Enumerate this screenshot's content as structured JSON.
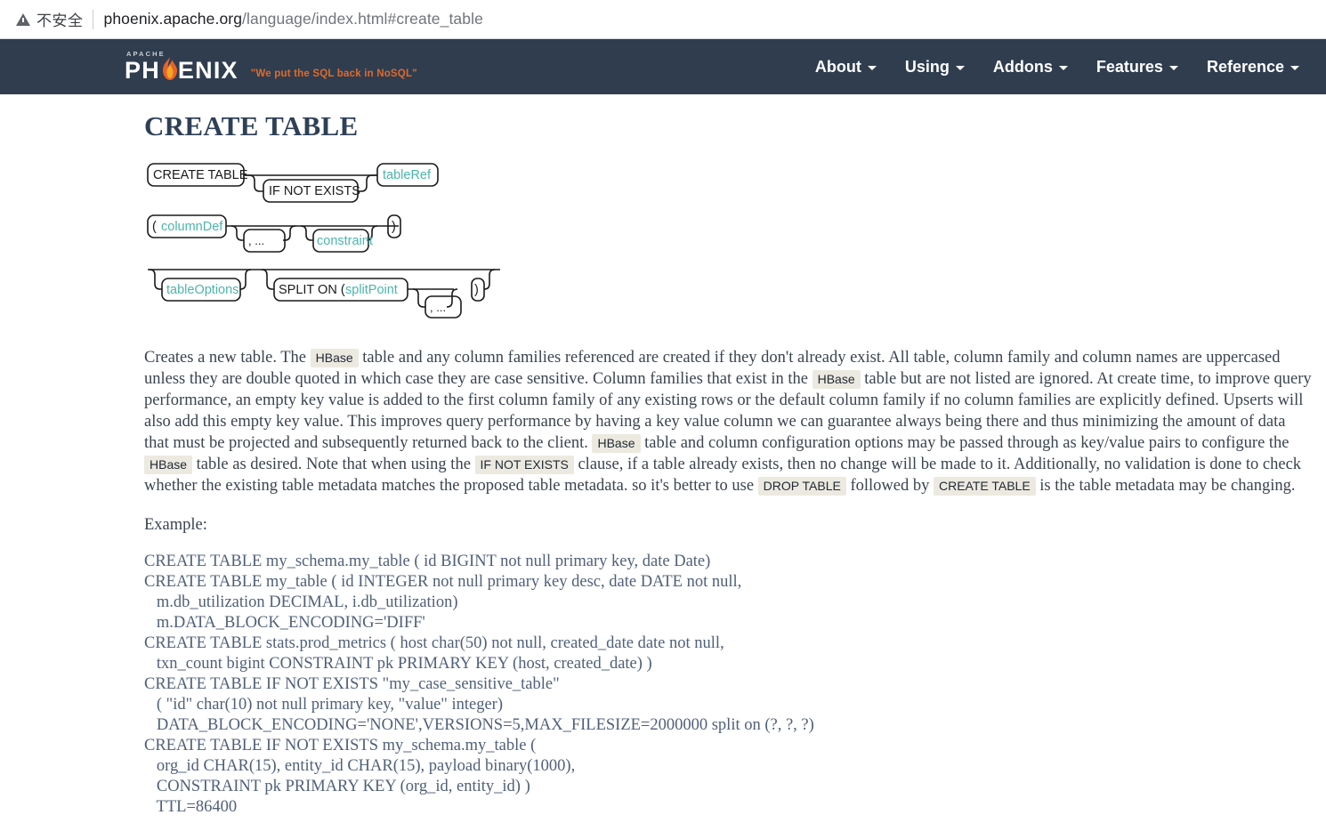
{
  "browser": {
    "security_label": "不安全",
    "warning_icon": "warning-triangle-icon",
    "url_host": "phoenix.apache.org",
    "url_path": "/language/index.html#create_table",
    "url_full": "phoenix.apache.org/language/index.html#create_table"
  },
  "header": {
    "logo_apache": "APACHE",
    "logo_ph": "PH",
    "logo_enix": "ENIX",
    "flame_icon": "flame-icon",
    "tagline": "\"We put the SQL back in NoSQL\"",
    "nav": [
      {
        "label": "About",
        "icon": "chevron-down-icon"
      },
      {
        "label": "Using",
        "icon": "chevron-down-icon"
      },
      {
        "label": "Addons",
        "icon": "chevron-down-icon"
      },
      {
        "label": "Features",
        "icon": "chevron-down-icon"
      },
      {
        "label": "Reference",
        "icon": "chevron-down-icon"
      }
    ]
  },
  "page": {
    "title": "CREATE TABLE"
  },
  "diagram": {
    "row1": {
      "create_table": "CREATE TABLE",
      "if_not_exists": "IF NOT EXISTS",
      "table_ref": "tableRef"
    },
    "row2": {
      "open_paren_columndef_paren": "(",
      "column_def": "columnDef",
      "loop": ", ...",
      "constraint": "constraint",
      "close_paren": ")"
    },
    "row3": {
      "table_options": "tableOptions",
      "split_on": "SPLIT ON  (",
      "split_point": "splitPoint",
      "loop": ", ...",
      "close_paren": ")"
    }
  },
  "colors": {
    "header_bg": "#2f3d4f",
    "link_teal": "#4cb5ac",
    "tagline_orange": "#e06a2b",
    "title_navy": "#2e4057",
    "code_bg": "#ece9e0",
    "code_text": "#50607a"
  },
  "body": {
    "paragraph_parts": [
      {
        "type": "text",
        "value": "Creates a new table. The "
      },
      {
        "type": "code",
        "value": "HBase"
      },
      {
        "type": "text",
        "value": " table and any column families referenced are created if they don't already exist. All table, column family and column names are uppercased unless they are double quoted in which case they are case sensitive. Column families that exist in the "
      },
      {
        "type": "code",
        "value": "HBase"
      },
      {
        "type": "text",
        "value": " table but are not listed are ignored. At create time, to improve query performance, an empty key value is added to the first column family of any existing rows or the default column family if no column families are explicitly defined. Upserts will also add this empty key value. This improves query performance by having a key value column we can guarantee always being there and thus minimizing the amount of data that must be projected and subsequently returned back to the client. "
      },
      {
        "type": "code",
        "value": "HBase"
      },
      {
        "type": "text",
        "value": " table and column configuration options may be passed through as key/value pairs to configure the "
      },
      {
        "type": "code",
        "value": "HBase"
      },
      {
        "type": "text",
        "value": " table as desired. Note that when using the "
      },
      {
        "type": "code",
        "value": "IF NOT EXISTS"
      },
      {
        "type": "text",
        "value": " clause, if a table already exists, then no change will be made to it. Additionally, no validation is done to check whether the existing table metadata matches the proposed table metadata. so it's better to use "
      },
      {
        "type": "code",
        "value": "DROP TABLE"
      },
      {
        "type": "text",
        "value": " followed by "
      },
      {
        "type": "code",
        "value": "CREATE TABLE"
      },
      {
        "type": "text",
        "value": " is the table metadata may be changing."
      }
    ],
    "example_label": "Example:",
    "example_code": "CREATE TABLE my_schema.my_table ( id BIGINT not null primary key, date Date)\nCREATE TABLE my_table ( id INTEGER not null primary key desc, date DATE not null,\n   m.db_utilization DECIMAL, i.db_utilization)\n   m.DATA_BLOCK_ENCODING='DIFF'\nCREATE TABLE stats.prod_metrics ( host char(50) not null, created_date date not null,\n   txn_count bigint CONSTRAINT pk PRIMARY KEY (host, created_date) )\nCREATE TABLE IF NOT EXISTS \"my_case_sensitive_table\"\n   ( \"id\" char(10) not null primary key, \"value\" integer)\n   DATA_BLOCK_ENCODING='NONE',VERSIONS=5,MAX_FILESIZE=2000000 split on (?, ?, ?)\nCREATE TABLE IF NOT EXISTS my_schema.my_table (\n   org_id CHAR(15), entity_id CHAR(15), payload binary(1000),\n   CONSTRAINT pk PRIMARY KEY (org_id, entity_id) )\n   TTL=86400"
  }
}
